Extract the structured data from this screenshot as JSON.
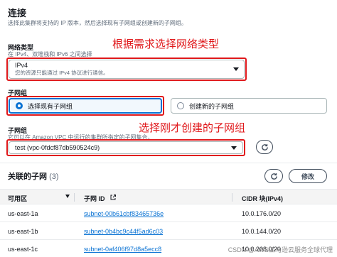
{
  "panel": {
    "title": "连接",
    "description": "选择此集群将支持的 IP 版本，然后选择现有子网组或创建新的子网组。"
  },
  "network_type": {
    "label": "网络类型",
    "hint": "在 IPv4、双堆栈和 IPv6 之间选择",
    "selected_value": "IPv4",
    "selected_desc": "您的资源只能通过 IPv4 协议进行通信。"
  },
  "annotations": {
    "network_type": "根据需求选择网络类型",
    "subnet_group": "选择刚才创建的子网组"
  },
  "subnet_group": {
    "label": "子网组",
    "option_existing": "选择现有子网组",
    "option_new": "创建新的子网组"
  },
  "subnet_select": {
    "label": "子网组",
    "hint": "它可以在 Amazon VPC 中运行的集群所指定的子网集合。",
    "selected_value": "test (vpc-0fdcf87db590524c9)"
  },
  "related_subnets": {
    "title": "关联的子网",
    "count": "(3)",
    "edit_label": "修改",
    "columns": [
      "可用区",
      "子网 ID",
      "CIDR 块(IPv4)"
    ],
    "rows": [
      {
        "az": "us-east-1a",
        "subnet": "subnet-00b61cbf83465736e",
        "cidr": "10.0.176.0/20"
      },
      {
        "az": "us-east-1b",
        "subnet": "subnet-0b4bc9c44f5ad6c03",
        "cidr": "10.0.144.0/20"
      },
      {
        "az": "us-east-1c",
        "subnet": "subnet-0af406f97d8a5ecc8",
        "cidr": "10.0.208.0/20"
      }
    ]
  },
  "watermark": "CSDN @AWS亚马逊云服务全球代理",
  "colors": {
    "accent": "#0972d3",
    "highlight": "#e0181b",
    "link": "#0972d3"
  }
}
